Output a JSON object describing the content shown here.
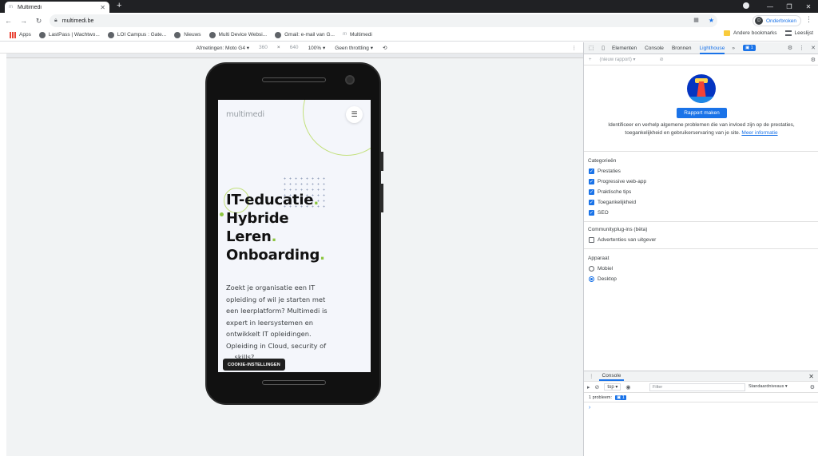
{
  "browser": {
    "tab_title": "Multimedi",
    "tab_favicon": "m",
    "url": "multimedi.be",
    "profile_initial": "D",
    "profile_label": "Onderbroken"
  },
  "bookmarks": {
    "items": [
      {
        "label": "Apps",
        "icon": "apps-grid-icon"
      },
      {
        "label": "LastPass | Wachtwo...",
        "icon": "globe-icon"
      },
      {
        "label": "LOI Campus : Gate...",
        "icon": "globe-icon"
      },
      {
        "label": "Nieuws",
        "icon": "globe-icon"
      },
      {
        "label": "Multi Device Websi...",
        "icon": "globe-icon"
      },
      {
        "label": "Gmail: e-mail van G...",
        "icon": "globe-icon"
      },
      {
        "label": "Multimedi",
        "icon": "m-icon"
      }
    ],
    "other_bookmarks": "Andere bookmarks",
    "reading_list": "Leeslijst"
  },
  "device_toolbar": {
    "dimensions_label": "Afmetingen: Moto G4",
    "width": "360",
    "height": "640",
    "zoom": "100%",
    "throttling": "Geen throttling"
  },
  "site": {
    "logo": "multimedi",
    "hero_lines": [
      "IT-educatie",
      "Hybride",
      "Leren",
      "Onboarding"
    ],
    "intro": "Zoekt je organisatie een IT opleiding of wil je starten met een leerplatform? Multimedi is expert in leersystemen en ontwikkelt IT opleidingen. Opleiding in Cloud, security of ... skills?",
    "cookie_button": "COOKIE-INSTELLINGEN"
  },
  "devtools": {
    "tabs": [
      "Elementen",
      "Console",
      "Bronnen",
      "Lighthouse"
    ],
    "active_tab": "Lighthouse",
    "issues_count": "1",
    "report_select": "(nieuw rapport)",
    "lighthouse": {
      "button": "Rapport maken",
      "description": "Identificeer en verhelp algemene problemen die van invloed zijn op de prestaties, toegankelijkheid en gebruikerservaring van je site.",
      "learn_more": "Meer informatie",
      "categories_title": "Categorieën",
      "categories": [
        {
          "label": "Prestaties",
          "checked": true
        },
        {
          "label": "Progressive web-app",
          "checked": true
        },
        {
          "label": "Praktische tips",
          "checked": true
        },
        {
          "label": "Toegankelijkheid",
          "checked": true
        },
        {
          "label": "SEO",
          "checked": true
        }
      ],
      "plugins_title": "Communityplug-ins (bèta)",
      "plugins": [
        {
          "label": "Advertenties van uitgever",
          "checked": false
        }
      ],
      "device_title": "Apparaat",
      "devices": [
        {
          "label": "Mobiel",
          "selected": false
        },
        {
          "label": "Desktop",
          "selected": true
        }
      ]
    },
    "console": {
      "title": "Console",
      "context": "top",
      "filter_placeholder": "Filter",
      "levels": "Standaardniveaus",
      "issues_text": "1 probleem:",
      "issues_count": "1",
      "prompt": "›"
    }
  },
  "colors": {
    "accent": "#1a73e8",
    "brand_green": "#8cc63f",
    "titlebar": "#202124"
  }
}
